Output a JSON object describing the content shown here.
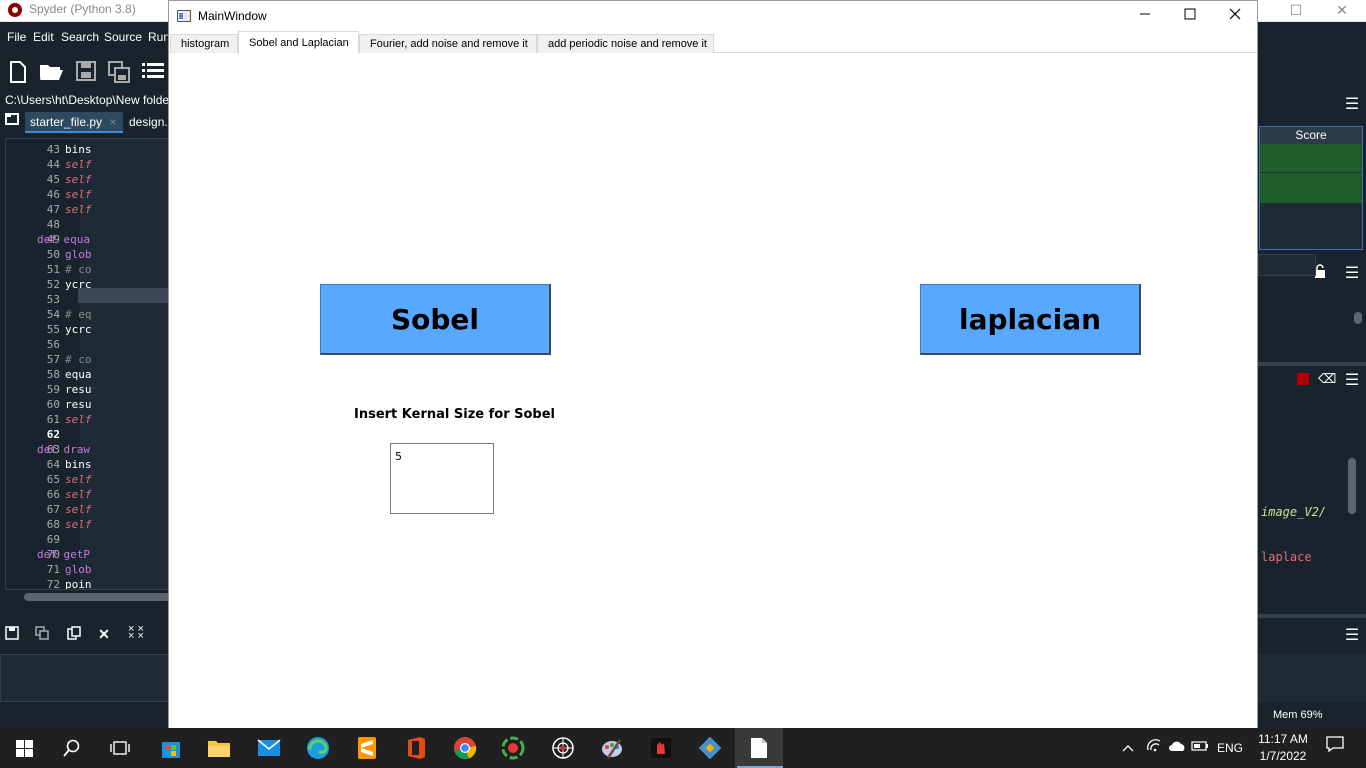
{
  "spyder": {
    "title": "Spyder (Python 3.8)",
    "menu": [
      "File",
      "Edit",
      "Search",
      "Source",
      "Run"
    ],
    "path": "C:\\Users\\ht\\Desktop\\New folder (",
    "tabs": [
      "starter_file.py",
      "design.p"
    ],
    "line_numbers": [
      "43",
      "44",
      "45",
      "46",
      "47",
      "48",
      "49",
      "50",
      "51",
      "52",
      "53",
      "54",
      "55",
      "56",
      "57",
      "58",
      "59",
      "60",
      "61",
      "62",
      "63",
      "64",
      "65",
      "66",
      "67",
      "68",
      "69",
      "70",
      "71",
      "72"
    ],
    "code_lines": [
      {
        "indent": 57,
        "text": "bins",
        "color": "#ffffff"
      },
      {
        "indent": 57,
        "text": "self",
        "color": "#e06c75",
        "italic": true
      },
      {
        "indent": 57,
        "text": "self",
        "color": "#e06c75",
        "italic": true
      },
      {
        "indent": 57,
        "text": "self",
        "color": "#e06c75",
        "italic": true
      },
      {
        "indent": 57,
        "text": "self",
        "color": "#e06c75",
        "italic": true
      },
      {
        "indent": 0,
        "text": "",
        "color": "#ffffff"
      },
      {
        "indent": 29,
        "text": "def equa",
        "color": "#c678dd"
      },
      {
        "indent": 57,
        "text": "glob",
        "color": "#c678dd"
      },
      {
        "indent": 57,
        "text": "# co",
        "color": "#888888"
      },
      {
        "indent": 57,
        "text": "ycrc",
        "color": "#ffffff"
      },
      {
        "indent": 0,
        "text": "",
        "color": "#ffffff"
      },
      {
        "indent": 57,
        "text": "# eq",
        "color": "#888888"
      },
      {
        "indent": 57,
        "text": "ycrc",
        "color": "#ffffff"
      },
      {
        "indent": 0,
        "text": "",
        "color": "#ffffff"
      },
      {
        "indent": 57,
        "text": "# co",
        "color": "#888888"
      },
      {
        "indent": 57,
        "text": "equa",
        "color": "#ffffff"
      },
      {
        "indent": 57,
        "text": "resu",
        "color": "#ffffff"
      },
      {
        "indent": 57,
        "text": "resu",
        "color": "#ffffff"
      },
      {
        "indent": 57,
        "text": "self",
        "color": "#e06c75",
        "italic": true
      },
      {
        "indent": 0,
        "text": "",
        "color": "#ffffff"
      },
      {
        "indent": 29,
        "text": "def draw",
        "color": "#c678dd"
      },
      {
        "indent": 57,
        "text": "bins",
        "color": "#ffffff"
      },
      {
        "indent": 57,
        "text": "self",
        "color": "#e06c75",
        "italic": true
      },
      {
        "indent": 57,
        "text": "self",
        "color": "#e06c75",
        "italic": true
      },
      {
        "indent": 57,
        "text": "self",
        "color": "#e06c75",
        "italic": true
      },
      {
        "indent": 57,
        "text": "self",
        "color": "#e06c75",
        "italic": true
      },
      {
        "indent": 0,
        "text": "",
        "color": "#ffffff"
      },
      {
        "indent": 29,
        "text": "def getP",
        "color": "#c678dd"
      },
      {
        "indent": 57,
        "text": "glob",
        "color": "#c678dd"
      },
      {
        "indent": 57,
        "text": "poin",
        "color": "#ffffff"
      }
    ],
    "right_pane": {
      "score_header": "Score",
      "text1": "image_V2/",
      "text2": "laplace",
      "mem": "Mem 69%"
    }
  },
  "main_window": {
    "title": "MainWindow",
    "tabs": [
      {
        "label": "histogram",
        "active": false
      },
      {
        "label": "Sobel and Laplacian",
        "active": true
      },
      {
        "label": "Fourier, add noise and remove it",
        "active": false
      },
      {
        "label": "add periodic noise and remove it",
        "active": false
      }
    ],
    "sobel_button": "Sobel",
    "laplacian_button": "laplacian",
    "kernel_label": "Insert Kernal Size for Sobel",
    "kernel_value": "5",
    "button_color": "#58a8ff"
  },
  "taskbar": {
    "apps": [
      "start",
      "search",
      "task-view",
      "microsoft-store",
      "file-explorer",
      "mail",
      "edge",
      "sublime-text",
      "office",
      "chrome",
      "anaconda",
      "spyder",
      "paint",
      "app-red",
      "git",
      "notepad"
    ],
    "language": "ENG",
    "time": "11:17 AM",
    "date": "1/7/2022"
  }
}
